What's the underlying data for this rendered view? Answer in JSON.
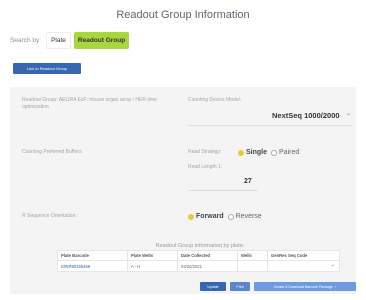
{
  "page_title": "Readout Group Information",
  "search": {
    "label": "Search by:",
    "options": [
      "Plate",
      "Readout Group"
    ],
    "selected": "Readout Group"
  },
  "link_button": "Link to Readout Group",
  "form": {
    "readout_group_label": "Readout Group: AELIRA ExF: mouse organ array / HER time optimization",
    "device_model_label": "Counting Device Model:",
    "device_model_value": "NextSeq 1000/2000",
    "preferred_buffers_label": "Counting Preferred Buffers:",
    "read_strategy_label": "Read Strategy:",
    "read_strategy_options": [
      "Single",
      "Paired"
    ],
    "read_strategy_selected": "Single",
    "read_length_label": "Read Length 1:",
    "read_length_value": "27",
    "orientation_label": "R Sequence Orientation:",
    "orientation_options": [
      "Forward",
      "Reverse"
    ],
    "orientation_selected": "Forward"
  },
  "table": {
    "caption": "Readout Group information by plate:",
    "columns": [
      "Plate Barcode",
      "Plate Wells",
      "Date Collected",
      "Wells",
      "GenRes Seq Code"
    ],
    "rows": [
      [
        "IONR90156459",
        "A - H",
        "04/20/2021",
        "",
        ""
      ]
    ]
  },
  "actions": {
    "update": "Update",
    "print": "Print",
    "export": "Create & Download Barcode Package"
  },
  "colors": {
    "accent_green": "#a7d63f",
    "primary_blue": "#3767b3",
    "radio_selected": "#e9c93a"
  }
}
